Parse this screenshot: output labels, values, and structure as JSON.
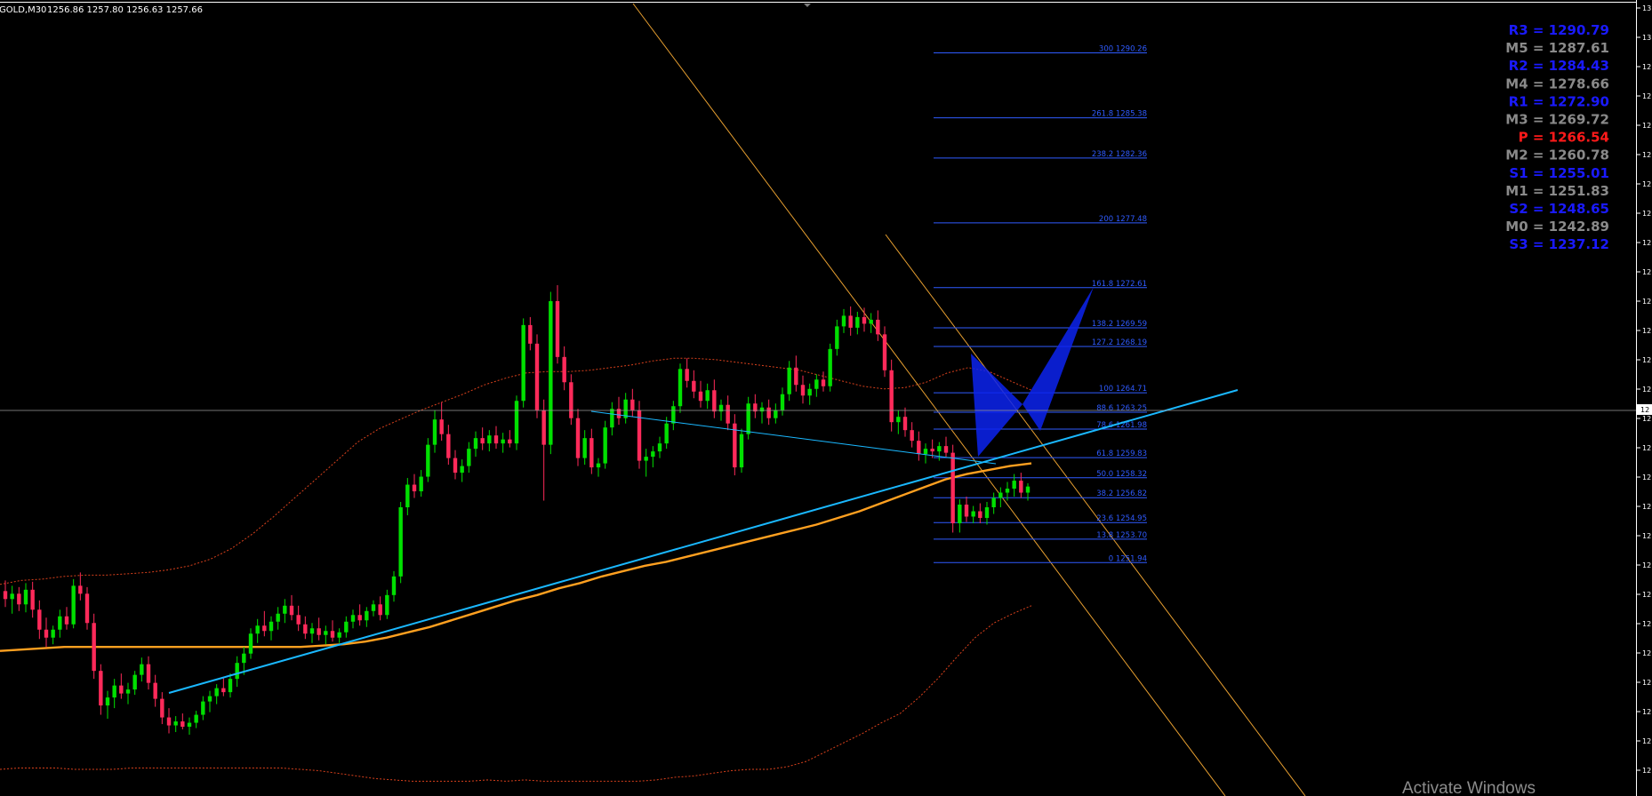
{
  "header": {
    "symbol": "GOLD,M30",
    "ohlc": "1256.86 1257.80 1256.63 1257.66"
  },
  "pivot_levels": [
    {
      "label": "R3 = 1290.79",
      "color": "#1a1aff"
    },
    {
      "label": "M5 = 1287.61",
      "color": "#8a8a8a"
    },
    {
      "label": "R2 = 1284.43",
      "color": "#1a1aff"
    },
    {
      "label": "M4 = 1278.66",
      "color": "#8a8a8a"
    },
    {
      "label": "R1 = 1272.90",
      "color": "#1a1aff"
    },
    {
      "label": "M3 = 1269.72",
      "color": "#8a8a8a"
    },
    {
      "label": "P  = 1266.54",
      "color": "#ff1a1a"
    },
    {
      "label": "M2 = 1260.78",
      "color": "#8a8a8a"
    },
    {
      "label": "S1 = 1255.01",
      "color": "#1a1aff"
    },
    {
      "label": "M1 = 1251.83",
      "color": "#8a8a8a"
    },
    {
      "label": "S2 = 1248.65",
      "color": "#1a1aff"
    },
    {
      "label": "M0 = 1242.89",
      "color": "#8a8a8a"
    },
    {
      "label": "S3 = 1237.12",
      "color": "#1a1aff"
    }
  ],
  "watermark": "Activate Windows",
  "colors": {
    "background": "#000000",
    "bull_candle": "#00e000",
    "bear_candle": "#ff2a5a",
    "moving_average": "#ffa020",
    "bands": "#d8401c",
    "trendline": "#1ab8ff",
    "channel": "#e8a030",
    "fibonacci": "#2f5bff",
    "pattern": "#1030ff"
  },
  "chart_data": {
    "type": "candlestick",
    "title": "GOLD,M30",
    "ylim": [
      1238,
      1292
    ],
    "y_tick_labels": [
      "13",
      "13",
      "12",
      "12",
      "12",
      "12",
      "12",
      "12",
      "12",
      "12",
      "12",
      "12",
      "12",
      "12",
      "12",
      "12",
      "12",
      "12",
      "12",
      "12",
      "12",
      "12",
      "12",
      "12",
      "12",
      "12",
      "12"
    ],
    "current_price_label": "12",
    "current_price": 1257.66,
    "candles": [
      [
        1249.8,
        1250.6,
        1248.6,
        1249.2
      ],
      [
        1249.2,
        1250.2,
        1248.1,
        1249.6
      ],
      [
        1249.6,
        1250.1,
        1248.3,
        1248.8
      ],
      [
        1248.8,
        1250.4,
        1248.2,
        1249.9
      ],
      [
        1249.9,
        1250.5,
        1247.8,
        1248.4
      ],
      [
        1248.4,
        1249.1,
        1246.2,
        1246.9
      ],
      [
        1246.9,
        1247.8,
        1245.6,
        1246.3
      ],
      [
        1246.3,
        1247.2,
        1245.8,
        1246.9
      ],
      [
        1246.9,
        1248.4,
        1246.3,
        1247.9
      ],
      [
        1247.9,
        1248.6,
        1246.9,
        1247.3
      ],
      [
        1247.3,
        1250.7,
        1247.0,
        1250.2
      ],
      [
        1250.2,
        1251.2,
        1249.1,
        1249.6
      ],
      [
        1249.6,
        1250.1,
        1246.9,
        1247.4
      ],
      [
        1247.4,
        1248.1,
        1243.2,
        1243.8
      ],
      [
        1243.8,
        1244.3,
        1240.5,
        1241.2
      ],
      [
        1241.2,
        1242.3,
        1240.2,
        1241.8
      ],
      [
        1241.8,
        1243.2,
        1241.0,
        1242.7
      ],
      [
        1242.7,
        1243.6,
        1241.7,
        1242.1
      ],
      [
        1242.1,
        1242.9,
        1241.3,
        1242.4
      ],
      [
        1242.4,
        1243.8,
        1242.0,
        1243.5
      ],
      [
        1243.5,
        1244.8,
        1243.0,
        1244.3
      ],
      [
        1244.3,
        1244.9,
        1242.4,
        1242.9
      ],
      [
        1242.9,
        1243.5,
        1241.1,
        1241.7
      ],
      [
        1241.7,
        1242.2,
        1239.8,
        1240.3
      ],
      [
        1240.3,
        1241.0,
        1239.1,
        1239.7
      ],
      [
        1239.7,
        1240.4,
        1239.2,
        1240.0
      ],
      [
        1240.0,
        1240.6,
        1239.4,
        1239.6
      ],
      [
        1239.6,
        1240.3,
        1239.0,
        1239.9
      ],
      [
        1239.9,
        1240.8,
        1239.5,
        1240.5
      ],
      [
        1240.5,
        1241.9,
        1240.1,
        1241.5
      ],
      [
        1241.5,
        1242.3,
        1240.7,
        1241.9
      ],
      [
        1241.9,
        1242.8,
        1241.3,
        1242.5
      ],
      [
        1242.5,
        1243.3,
        1241.9,
        1242.2
      ],
      [
        1242.2,
        1243.6,
        1241.8,
        1243.2
      ],
      [
        1243.2,
        1244.9,
        1242.6,
        1244.4
      ],
      [
        1244.4,
        1245.6,
        1243.5,
        1245.1
      ],
      [
        1245.1,
        1247.0,
        1244.7,
        1246.6
      ],
      [
        1246.6,
        1247.7,
        1245.9,
        1247.2
      ],
      [
        1247.2,
        1248.3,
        1246.4,
        1246.8
      ],
      [
        1246.8,
        1247.9,
        1246.1,
        1247.5
      ],
      [
        1247.5,
        1248.6,
        1246.9,
        1248.1
      ],
      [
        1248.1,
        1249.2,
        1247.4,
        1248.7
      ],
      [
        1248.7,
        1249.5,
        1247.6,
        1248.0
      ],
      [
        1248.0,
        1248.7,
        1246.8,
        1247.3
      ],
      [
        1247.3,
        1247.9,
        1246.2,
        1246.6
      ],
      [
        1246.6,
        1247.4,
        1245.9,
        1247.0
      ],
      [
        1247.0,
        1247.8,
        1246.1,
        1246.5
      ],
      [
        1246.5,
        1247.2,
        1245.8,
        1246.8
      ],
      [
        1246.8,
        1247.6,
        1246.0,
        1246.3
      ],
      [
        1246.3,
        1247.0,
        1245.9,
        1246.7
      ],
      [
        1246.7,
        1247.9,
        1246.3,
        1247.5
      ],
      [
        1247.5,
        1248.4,
        1247.0,
        1248.0
      ],
      [
        1248.0,
        1248.8,
        1247.2,
        1247.6
      ],
      [
        1247.6,
        1248.6,
        1247.1,
        1248.3
      ],
      [
        1248.3,
        1249.1,
        1247.9,
        1248.8
      ],
      [
        1248.8,
        1249.4,
        1247.6,
        1248.0
      ],
      [
        1248.0,
        1249.9,
        1247.7,
        1249.5
      ],
      [
        1249.5,
        1251.3,
        1249.0,
        1250.9
      ],
      [
        1250.9,
        1256.5,
        1250.4,
        1256.1
      ],
      [
        1256.1,
        1258.3,
        1255.5,
        1257.8
      ],
      [
        1257.8,
        1258.6,
        1256.8,
        1257.3
      ],
      [
        1257.3,
        1258.9,
        1256.9,
        1258.4
      ],
      [
        1258.4,
        1261.3,
        1258.0,
        1260.8
      ],
      [
        1260.8,
        1263.4,
        1260.2,
        1262.7
      ],
      [
        1262.7,
        1264.0,
        1261.1,
        1261.6
      ],
      [
        1261.6,
        1262.3,
        1259.3,
        1259.8
      ],
      [
        1259.8,
        1260.4,
        1258.2,
        1258.7
      ],
      [
        1258.7,
        1259.7,
        1258.0,
        1259.2
      ],
      [
        1259.2,
        1261.0,
        1258.7,
        1260.5
      ],
      [
        1260.5,
        1261.8,
        1259.9,
        1261.3
      ],
      [
        1261.3,
        1262.1,
        1260.4,
        1260.9
      ],
      [
        1260.9,
        1261.9,
        1260.3,
        1261.5
      ],
      [
        1261.5,
        1262.2,
        1260.5,
        1260.9
      ],
      [
        1260.9,
        1261.7,
        1260.2,
        1261.2
      ],
      [
        1261.2,
        1261.9,
        1260.6,
        1260.9
      ],
      [
        1260.9,
        1264.5,
        1260.4,
        1264.1
      ],
      [
        1264.1,
        1270.3,
        1263.6,
        1269.8
      ],
      [
        1269.8,
        1270.4,
        1267.9,
        1268.4
      ],
      [
        1268.4,
        1269.1,
        1262.8,
        1263.4
      ],
      [
        1263.4,
        1264.2,
        1256.6,
        1260.8
      ],
      [
        1260.8,
        1272.3,
        1260.1,
        1271.6
      ],
      [
        1271.6,
        1272.8,
        1266.9,
        1267.4
      ],
      [
        1267.4,
        1268.2,
        1264.9,
        1265.5
      ],
      [
        1265.5,
        1266.1,
        1262.3,
        1262.8
      ],
      [
        1262.8,
        1263.5,
        1259.2,
        1259.8
      ],
      [
        1259.8,
        1261.9,
        1259.3,
        1261.3
      ],
      [
        1261.3,
        1262.0,
        1258.6,
        1259.1
      ],
      [
        1259.1,
        1259.8,
        1258.4,
        1259.4
      ],
      [
        1259.4,
        1262.6,
        1259.0,
        1262.1
      ],
      [
        1262.1,
        1264.0,
        1261.5,
        1263.5
      ],
      [
        1263.5,
        1264.4,
        1262.3,
        1262.8
      ],
      [
        1262.8,
        1264.7,
        1262.4,
        1264.2
      ],
      [
        1264.2,
        1265.0,
        1262.9,
        1263.4
      ],
      [
        1263.4,
        1264.1,
        1259.0,
        1259.6
      ],
      [
        1259.6,
        1260.5,
        1258.4,
        1259.9
      ],
      [
        1259.9,
        1260.7,
        1259.1,
        1260.3
      ],
      [
        1260.3,
        1261.4,
        1259.8,
        1260.9
      ],
      [
        1260.9,
        1262.9,
        1260.5,
        1262.4
      ],
      [
        1262.4,
        1264.1,
        1261.9,
        1263.7
      ],
      [
        1263.7,
        1266.9,
        1263.2,
        1266.5
      ],
      [
        1266.5,
        1267.3,
        1265.1,
        1265.6
      ],
      [
        1265.6,
        1266.4,
        1264.3,
        1264.8
      ],
      [
        1264.8,
        1265.6,
        1263.6,
        1264.1
      ],
      [
        1264.1,
        1265.4,
        1263.5,
        1264.9
      ],
      [
        1264.9,
        1265.7,
        1262.8,
        1263.3
      ],
      [
        1263.3,
        1264.2,
        1262.6,
        1263.8
      ],
      [
        1263.8,
        1264.5,
        1261.9,
        1262.4
      ],
      [
        1262.4,
        1263.1,
        1258.5,
        1259.1
      ],
      [
        1259.1,
        1262.0,
        1258.7,
        1261.6
      ],
      [
        1261.6,
        1264.4,
        1261.2,
        1263.9
      ],
      [
        1263.9,
        1264.6,
        1262.8,
        1263.3
      ],
      [
        1263.3,
        1264.0,
        1262.4,
        1263.6
      ],
      [
        1263.6,
        1264.2,
        1262.3,
        1262.8
      ],
      [
        1262.8,
        1263.9,
        1262.4,
        1263.4
      ],
      [
        1263.4,
        1265.1,
        1263.0,
        1264.6
      ],
      [
        1264.6,
        1267.1,
        1264.1,
        1266.6
      ],
      [
        1266.6,
        1267.5,
        1264.8,
        1265.3
      ],
      [
        1265.3,
        1266.0,
        1263.9,
        1264.5
      ],
      [
        1264.5,
        1265.4,
        1263.8,
        1265.0
      ],
      [
        1265.0,
        1266.1,
        1264.4,
        1265.7
      ],
      [
        1265.7,
        1266.3,
        1264.8,
        1265.2
      ],
      [
        1265.2,
        1268.4,
        1264.8,
        1268.0
      ],
      [
        1268.0,
        1270.2,
        1267.5,
        1269.7
      ],
      [
        1269.7,
        1271.0,
        1269.2,
        1270.5
      ],
      [
        1270.5,
        1271.2,
        1269.0,
        1269.6
      ],
      [
        1269.6,
        1270.8,
        1269.1,
        1270.4
      ],
      [
        1270.4,
        1271.1,
        1269.3,
        1269.9
      ],
      [
        1269.9,
        1270.7,
        1269.2,
        1270.2
      ],
      [
        1270.2,
        1270.9,
        1268.6,
        1269.1
      ],
      [
        1269.1,
        1269.7,
        1265.9,
        1266.4
      ],
      [
        1266.4,
        1267.2,
        1261.8,
        1262.5
      ],
      [
        1262.5,
        1263.4,
        1261.6,
        1262.9
      ],
      [
        1262.9,
        1263.6,
        1261.4,
        1261.9
      ],
      [
        1261.9,
        1262.5,
        1260.6,
        1261.1
      ],
      [
        1261.1,
        1261.8,
        1259.6,
        1260.1
      ],
      [
        1260.1,
        1260.9,
        1259.4,
        1260.5
      ],
      [
        1260.5,
        1261.2,
        1259.8,
        1260.3
      ],
      [
        1260.3,
        1261.0,
        1259.6,
        1260.7
      ],
      [
        1260.7,
        1261.4,
        1259.9,
        1260.2
      ],
      [
        1260.2,
        1260.8,
        1254.2,
        1254.9
      ],
      [
        1254.9,
        1256.7,
        1254.2,
        1256.3
      ],
      [
        1256.3,
        1256.9,
        1255.0,
        1255.4
      ],
      [
        1255.4,
        1256.2,
        1254.9,
        1255.8
      ],
      [
        1255.8,
        1256.4,
        1254.9,
        1255.3
      ],
      [
        1255.3,
        1256.5,
        1254.8,
        1256.1
      ],
      [
        1256.1,
        1257.2,
        1255.6,
        1256.8
      ],
      [
        1256.8,
        1257.6,
        1256.1,
        1257.2
      ],
      [
        1257.2,
        1258.0,
        1256.6,
        1257.5
      ],
      [
        1257.5,
        1258.6,
        1256.9,
        1258.1
      ],
      [
        1258.1,
        1258.7,
        1256.8,
        1257.2
      ],
      [
        1257.2,
        1257.9,
        1256.6,
        1257.66
      ]
    ],
    "series": [
      {
        "type": "line",
        "values": [
          1245.3,
          1245.4,
          1245.5,
          1245.6,
          1245.6,
          1245.6,
          1245.6,
          1245.6,
          1245.6,
          1245.6,
          1245.6,
          1245.6,
          1245.6,
          1245.6,
          1245.6,
          1245.7,
          1245.8,
          1246.0,
          1246.3,
          1246.7,
          1247.1,
          1247.6,
          1248.1,
          1248.6,
          1249.1,
          1249.5,
          1250.0,
          1250.4,
          1250.9,
          1251.3,
          1251.7,
          1252.0,
          1252.4,
          1252.8,
          1253.2,
          1253.6,
          1254.0,
          1254.4,
          1254.8,
          1255.3,
          1255.8,
          1256.4,
          1257.0,
          1257.6,
          1258.2,
          1258.6,
          1258.9,
          1259.2,
          1259.4
        ]
      },
      {
        "type": "line",
        "values": [
          1250.3,
          1250.6,
          1250.7,
          1250.9,
          1251.0,
          1251.0,
          1251.1,
          1251.2,
          1251.4,
          1251.7,
          1252.2,
          1253.0,
          1254.1,
          1255.4,
          1256.8,
          1258.2,
          1259.6,
          1261.0,
          1262.0,
          1262.7,
          1263.4,
          1264.0,
          1264.6,
          1265.3,
          1265.8,
          1266.2,
          1266.3,
          1266.3,
          1266.4,
          1266.6,
          1266.8,
          1267.1,
          1267.3,
          1267.3,
          1267.2,
          1267.0,
          1266.8,
          1266.6,
          1266.4,
          1266.0,
          1265.6,
          1265.2,
          1265.0,
          1265.1,
          1265.5,
          1266.2,
          1266.6,
          1266.3,
          1265.6,
          1264.9
        ]
      },
      {
        "type": "line",
        "values": [
          1236.4,
          1236.5,
          1236.5,
          1236.5,
          1236.4,
          1236.4,
          1236.4,
          1236.5,
          1236.5,
          1236.5,
          1236.5,
          1236.5,
          1236.5,
          1236.5,
          1236.5,
          1236.5,
          1236.4,
          1236.3,
          1236.1,
          1235.9,
          1235.7,
          1235.6,
          1235.5,
          1235.5,
          1235.5,
          1235.5,
          1235.6,
          1235.5,
          1235.6,
          1235.5,
          1235.5,
          1235.5,
          1235.5,
          1235.5,
          1235.5,
          1235.6,
          1235.8,
          1235.9,
          1236.1,
          1236.3,
          1236.4,
          1236.4,
          1236.6,
          1237.0,
          1237.7,
          1238.4,
          1239.1,
          1239.9,
          1240.6,
          1241.8,
          1243.2,
          1244.8,
          1246.3,
          1247.4,
          1248.1,
          1248.7
        ]
      }
    ]
  },
  "fibonacci_levels": [
    {
      "label": "300 1290.26",
      "price": 1290.26
    },
    {
      "label": "261.8 1285.38",
      "price": 1285.38
    },
    {
      "label": "238.2 1282.36",
      "price": 1282.36
    },
    {
      "label": "200 1277.48",
      "price": 1277.48
    },
    {
      "label": "161.8 1272.61",
      "price": 1272.61
    },
    {
      "label": "138.2 1269.59",
      "price": 1269.59
    },
    {
      "label": "127.2 1268.19",
      "price": 1268.19
    },
    {
      "label": "100 1264.71",
      "price": 1264.71
    },
    {
      "label": "88.6 1263.25",
      "price": 1263.25
    },
    {
      "label": "78.6 1261.98",
      "price": 1261.98
    },
    {
      "label": "61.8 1259.83",
      "price": 1259.83
    },
    {
      "label": "50.0 1258.32",
      "price": 1258.32
    },
    {
      "label": "38.2 1256.82",
      "price": 1256.82
    },
    {
      "label": "23.6 1254.95",
      "price": 1254.95
    },
    {
      "label": "13.8 1253.70",
      "price": 1253.7
    },
    {
      "label": "0 1251.94",
      "price": 1251.94
    }
  ]
}
